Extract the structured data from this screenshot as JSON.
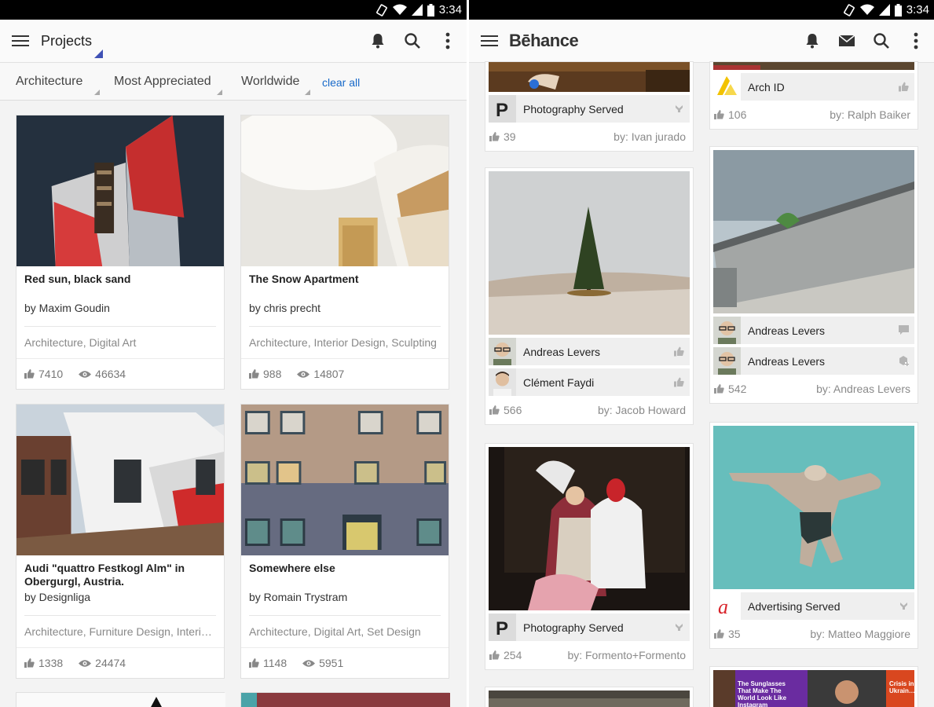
{
  "status": {
    "time": "3:34"
  },
  "left": {
    "appbar_title": "Projects",
    "filters": [
      {
        "label": "Architecture"
      },
      {
        "label": "Most Appreciated"
      },
      {
        "label": "Worldwide"
      }
    ],
    "clear_all": "clear all",
    "cards": [
      {
        "title": "Red sun, black sand",
        "by": "by Maxim Goudin",
        "tags": "Architecture, Digital Art",
        "likes": "7410",
        "views": "46634"
      },
      {
        "title": "The Snow Apartment",
        "by": "by chris precht",
        "tags": "Architecture, Interior Design, Sculpting",
        "likes": "988",
        "views": "14807"
      },
      {
        "title": "Audi \"quattro Festkogl Alm\" in Obergurgl, Austria.",
        "by": "by Designliga",
        "tags": "Architecture, Furniture Design, Interio…",
        "likes": "1338",
        "views": "24474"
      },
      {
        "title": "Somewhere else",
        "by": "by Romain Trystram",
        "tags": "Architecture, Digital Art, Set Design",
        "likes": "1148",
        "views": "5951"
      }
    ]
  },
  "right": {
    "brand": "Bēhance",
    "col1": [
      {
        "owners": [
          "Photography Served"
        ],
        "likes": "39",
        "by": "by: Ivan jurado"
      },
      {
        "owners": [
          "Andreas Levers",
          "Clément Faydi"
        ],
        "likes": "566",
        "by": "by: Jacob Howard"
      },
      {
        "owners": [
          "Photography Served"
        ],
        "likes": "254",
        "by": "by: Formento+Formento"
      }
    ],
    "col2": [
      {
        "owners": [
          "Arch ID"
        ],
        "likes": "106",
        "by": "by: Ralph Baiker"
      },
      {
        "owners": [
          "Andreas Levers",
          "Andreas Levers"
        ],
        "likes": "542",
        "by": "by: Andreas Levers"
      },
      {
        "owners": [
          "Advertising Served"
        ],
        "likes": "35",
        "by": "by: Matteo Maggiore"
      }
    ],
    "partial_card_text": "The Sunglasses That Make The World Look Like Instagram",
    "partial_card_side": "Crisis in Ukrain…"
  },
  "colors": {
    "accent": "#3f51b5",
    "link": "#1769c9",
    "statusbar": "#000000"
  }
}
